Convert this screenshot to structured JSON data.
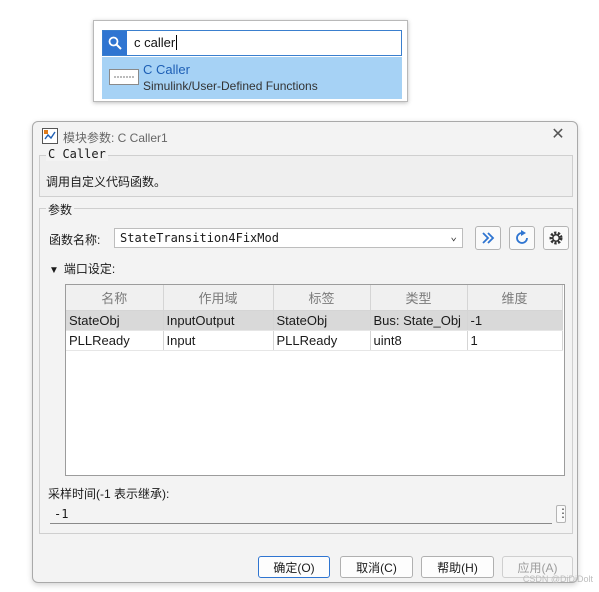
{
  "search": {
    "query": "c caller",
    "result": {
      "title": "C Caller",
      "path": "Simulink/User-Defined Functions"
    }
  },
  "dialog": {
    "title": "模块参数: C Caller1",
    "close_label": "✕",
    "description": {
      "block_name": "C Caller",
      "text": "调用自定义代码函数。"
    },
    "params": {
      "legend": "参数",
      "function_label": "函数名称:",
      "function_value": "StateTransition4FixMod",
      "port_settings_label": "端口设定:",
      "table": {
        "columns": [
          "名称",
          "作用域",
          "标签",
          "类型",
          "维度"
        ],
        "rows": [
          [
            "StateObj",
            "InputOutput",
            "StateObj",
            "Bus: State_Obj",
            "-1"
          ],
          [
            "PLLReady",
            "Input",
            "PLLReady",
            "uint8",
            "1"
          ]
        ]
      },
      "sample_time_label": "采样时间(-1 表示继承):",
      "sample_time_value": "-1"
    },
    "buttons": {
      "ok": "确定(O)",
      "cancel": "取消(C)",
      "help": "帮助(H)",
      "apply": "应用(A)"
    }
  },
  "watermark": "CSDN @DiDiDolt",
  "colors": {
    "accent": "#2f75d1",
    "selection": "#a6d2f5",
    "row_selected": "#d9d9d9"
  }
}
